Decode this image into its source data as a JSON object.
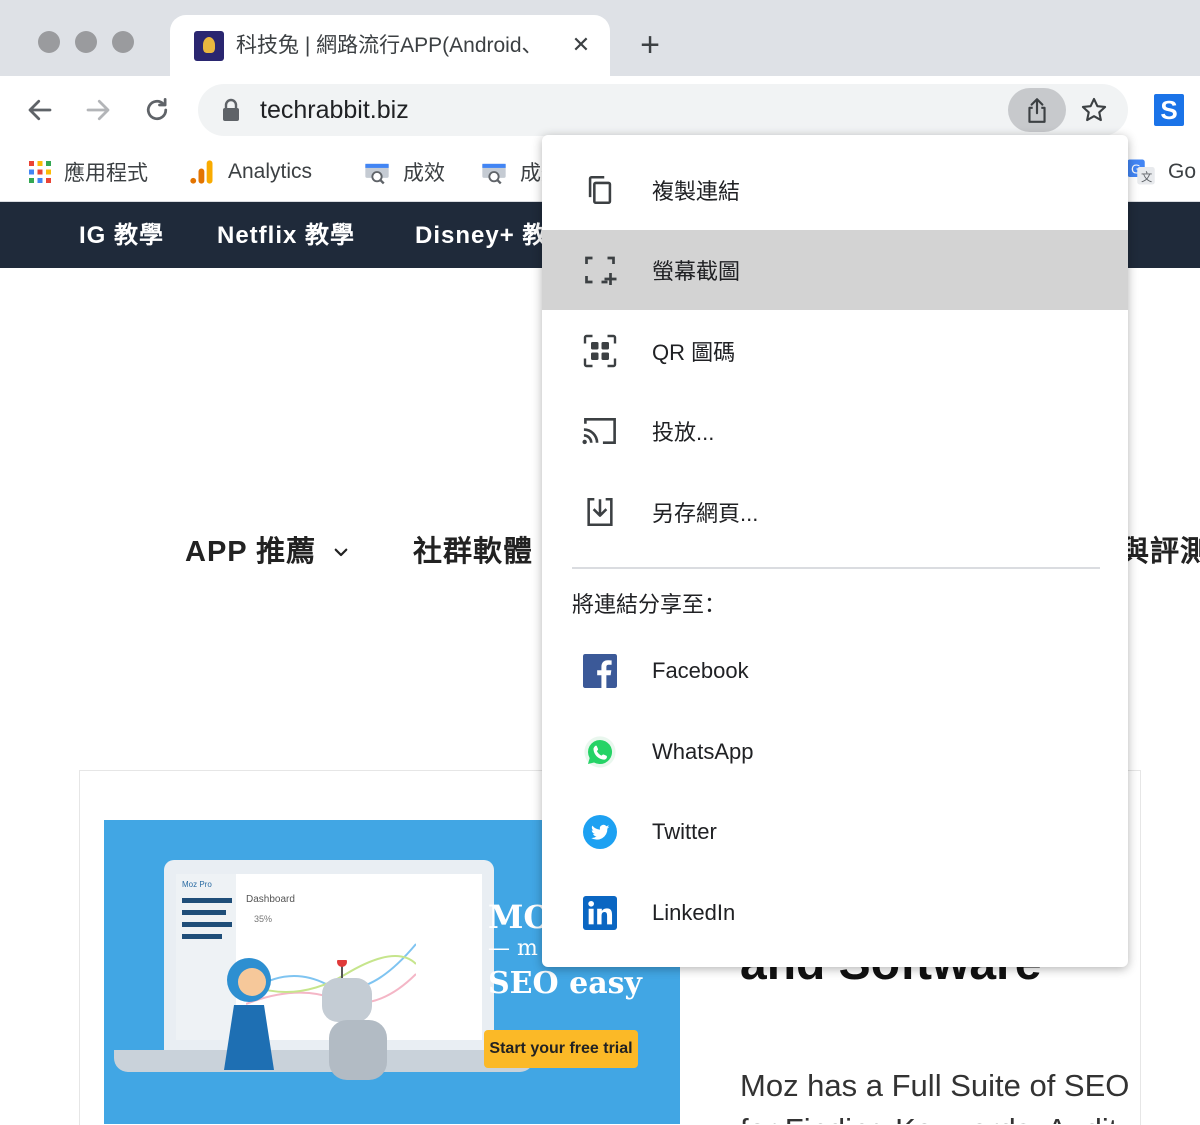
{
  "tab": {
    "title": "科技兔 | 網路流行APP(Android、iOS)",
    "close": "✕",
    "new_tab": "+"
  },
  "omnibox": {
    "url": "techrabbit.biz"
  },
  "extension": {
    "letter": "S"
  },
  "bookmarks": [
    {
      "label": "應用程式",
      "icon": "apps-grid-icon"
    },
    {
      "label": "Analytics",
      "icon": "analytics-icon"
    },
    {
      "label": "成效",
      "icon": "search-console-icon"
    },
    {
      "label": "成效",
      "icon": "search-console-icon"
    },
    {
      "label": "Go",
      "icon": "google-translate-icon"
    }
  ],
  "site_nav": [
    "IG 教學",
    "Netflix 教學",
    "Disney+ 教學"
  ],
  "page_menu": [
    "APP 推薦",
    "社群軟體",
    "與評測"
  ],
  "ad": {
    "brand_partial": "MO",
    "sub_partial": "— m",
    "headline": "SEO easy",
    "cta": "Start your free trial",
    "screen_title": "Dashboard",
    "screen_value": "35%",
    "screen_label": "Moz Pro"
  },
  "article": {
    "heading_partial": "and Software",
    "body_line1": "Moz has a Full Suite of SEO",
    "body_line2": "for Finding Keywords, Audit"
  },
  "share_menu": {
    "items": [
      {
        "label": "複製連結",
        "icon": "copy-link-icon"
      },
      {
        "label": "螢幕截圖",
        "icon": "screenshot-icon",
        "highlighted": true
      },
      {
        "label": "QR 圖碼",
        "icon": "qr-code-icon"
      },
      {
        "label": "投放...",
        "icon": "cast-icon"
      },
      {
        "label": "另存網頁...",
        "icon": "save-page-icon"
      }
    ],
    "share_header": "將連結分享至：",
    "targets": [
      {
        "label": "Facebook",
        "icon": "facebook-icon",
        "color": "#3b5998"
      },
      {
        "label": "WhatsApp",
        "icon": "whatsapp-icon",
        "color": "#25d366"
      },
      {
        "label": "Twitter",
        "icon": "twitter-icon",
        "color": "#1da1f2"
      },
      {
        "label": "LinkedIn",
        "icon": "linkedin-icon",
        "color": "#0a66c2"
      }
    ]
  }
}
